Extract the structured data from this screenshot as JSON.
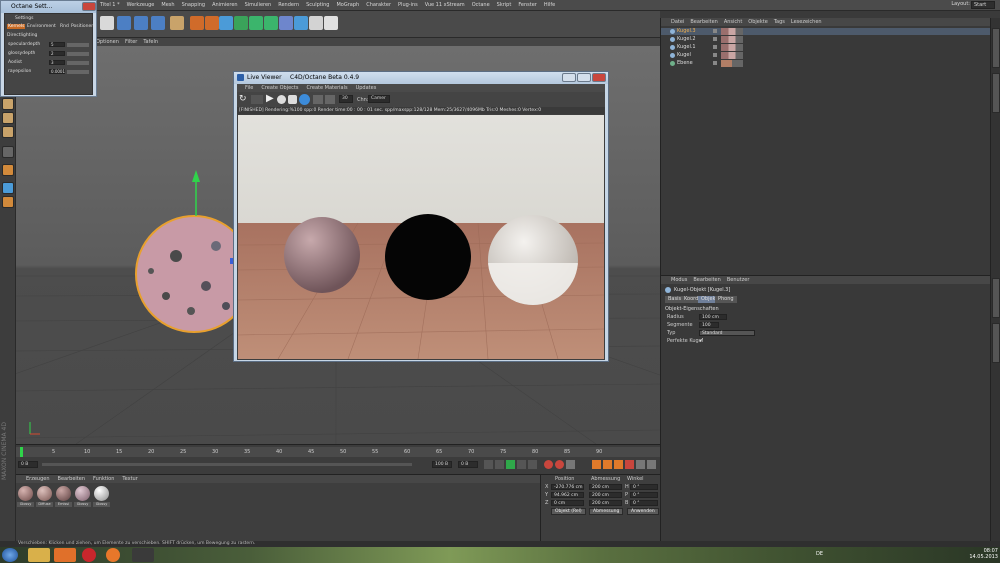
{
  "app": {
    "title_tab": "Titel 1 *",
    "menu": [
      "Werkzeuge",
      "Mesh",
      "Snapping",
      "Animieren",
      "Simulieren",
      "Rendern",
      "Sculpting",
      "MoGraph",
      "Charakter",
      "Plug-ins",
      "Vue 11 xStream",
      "Octane",
      "Skript",
      "Fenster",
      "Hilfe"
    ],
    "layout_label": "Layout:",
    "layout_value": "Start"
  },
  "viewport": {
    "menu": [
      "Optionen",
      "Filter",
      "Tafeln"
    ]
  },
  "octane_settings": {
    "title": "Octane Sett...",
    "header": "Settings",
    "tabs": [
      "Kernels",
      "Environment",
      "Rnd",
      "Positionen"
    ],
    "section": "Directlighting",
    "rows": [
      {
        "label": "speculardepth",
        "value": "5"
      },
      {
        "label": "glossydepth",
        "value": "2"
      },
      {
        "label": "Aodist",
        "value": "3"
      },
      {
        "label": "rayepsilon",
        "value": "0.0001"
      }
    ]
  },
  "live_viewer": {
    "title": "Live Viewer",
    "subtitle": "C4D/Octane Beta 0.4.9",
    "menu": [
      "File",
      "Create Objects",
      "Create Materials",
      "Updates"
    ],
    "samples_value": "30",
    "channel_label": "Chn:",
    "channel_value": "Camer",
    "status_line": "[FINISHED] Rendering:%100 spp:0 Render time:00 : 00 : 01 sec. spp/maxspp:128/128 Mem:25/3627/4096Mb Tris:0 Meshes:0 Vertex:0"
  },
  "object_manager": {
    "menu": [
      "Datei",
      "Bearbeiten",
      "Ansicht",
      "Objekte",
      "Tags",
      "Lesezeichen"
    ],
    "objects": [
      {
        "name": "Kugel.3"
      },
      {
        "name": "Kugel.2"
      },
      {
        "name": "Kugel.1"
      },
      {
        "name": "Kugel"
      },
      {
        "name": "Ebene"
      }
    ]
  },
  "attribute_manager": {
    "menu": [
      "Modus",
      "Bearbeiten",
      "Benutzer"
    ],
    "object_title": "Kugel-Objekt [Kugel.3]",
    "tabs": [
      "Basis",
      "Koord.",
      "Objekt",
      "Phong"
    ],
    "section": "Objekt-Eigenschaften",
    "rows": [
      {
        "label": "Radius",
        "value": "100 cm"
      },
      {
        "label": "Segmente",
        "value": "100"
      },
      {
        "label": "Typ",
        "value": "Standard"
      },
      {
        "label": "Perfekte Kugel",
        "value": "✓"
      }
    ]
  },
  "timeline": {
    "ticks": [
      "0",
      "5",
      "10",
      "15",
      "20",
      "25",
      "30",
      "35",
      "40",
      "45",
      "50",
      "55",
      "60",
      "65",
      "70",
      "75",
      "80",
      "85",
      "90"
    ],
    "start_frame": "0 B",
    "end_frame": "100 B",
    "current_frame": "0 B"
  },
  "material_manager": {
    "menu": [
      "Erzeugen",
      "Bearbeiten",
      "Funktion",
      "Textur"
    ],
    "materials": [
      {
        "name": "Glossy",
        "color": "#9a6f6d"
      },
      {
        "name": "Diffuse",
        "color": "#a07b77"
      },
      {
        "name": "Emissi",
        "color": "#8d6a6a"
      },
      {
        "name": "Glossy",
        "color": "#a98995"
      },
      {
        "name": "Glossy",
        "color": "#c9c9c9"
      }
    ]
  },
  "coordinates": {
    "headers": [
      "Position",
      "Abmessung",
      "Winkel"
    ],
    "rows": [
      {
        "axis": "X",
        "pos": "-270.776 cm",
        "size": "200 cm",
        "angle_label": "H",
        "angle": "0 °"
      },
      {
        "axis": "Y",
        "pos": "94.962 cm",
        "size": "200 cm",
        "angle_label": "P",
        "angle": "0 °"
      },
      {
        "axis": "Z",
        "pos": "0 cm",
        "size": "200 cm",
        "angle_label": "B",
        "angle": "0 °"
      }
    ],
    "mode_select": "Objekt (Rel)",
    "size_select": "Abmessung",
    "apply_button": "Anwenden"
  },
  "status_bar": {
    "text": "Verschieben: Klicken und ziehen, um Elemente zu verschieben. SHIFT drücken, um Bewegung zu rastern."
  },
  "taskbar": {
    "lang": "DE",
    "time": "08:07",
    "date": "14.05.2013"
  },
  "colors": {
    "accent_orange": "#e8a02e",
    "y_axis_green": "#2fd44a",
    "floor_tile": "#b27e66"
  }
}
